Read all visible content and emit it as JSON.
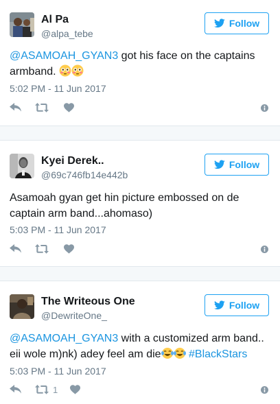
{
  "follow_label": "Follow",
  "tweets": [
    {
      "name": "Al Pa",
      "handle": "@alpa_tebe",
      "mention": "@ASAMOAH_GYAN3",
      "text_line1_rest": " got his face on the captains",
      "text_line2": "armband.",
      "emoji": "flushed-face, flushed-face",
      "time": "5:02 PM - 11 Jun 2017",
      "retweet_count": ""
    },
    {
      "name": "Kyei Derek..",
      "handle": "@69c746fb14e442b",
      "text_line1": "Asamoah gyan get hin picture embossed on de",
      "text_line2": "captain arm band...ahomaso)",
      "time": "5:03 PM - 11 Jun 2017",
      "retweet_count": ""
    },
    {
      "name": "The Writeous One",
      "handle": "@DewriteOne_",
      "mention": "@ASAMOAH_GYAN3",
      "text_line1_rest": " with a customized arm band..",
      "text_line2": "eii wole m)nk) adey feel am die",
      "emoji": "tears-of-joy, tears-of-joy",
      "hashtag": "#BlackStars",
      "time": "5:03 PM - 11 Jun 2017",
      "retweet_count": "1"
    }
  ],
  "icons": [
    "twitter-bird-icon",
    "reply-icon",
    "retweet-icon",
    "like-heart-icon",
    "info-icon"
  ],
  "colors": {
    "accent": "#1da1f2",
    "link": "#1b95e0",
    "muted": "#657786",
    "action": "#8899a6"
  }
}
